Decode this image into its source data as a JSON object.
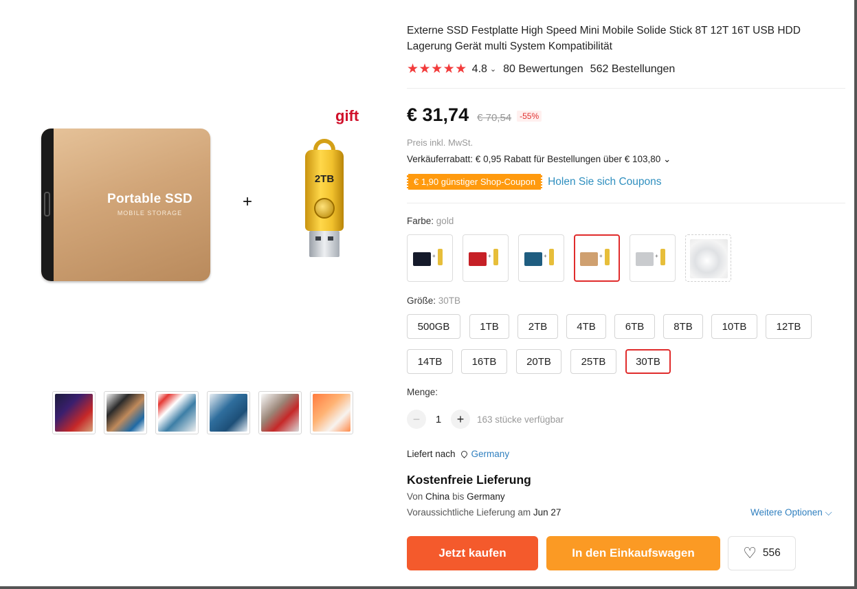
{
  "product": {
    "title": "Externe SSD Festplatte High Speed Mini Mobile Solide Stick 8T 12T 16T USB HDD Lagerung Gerät multi System Kompatibilität",
    "image": {
      "ssd_label": "Portable SSD",
      "ssd_sublabel": "MOBILE STORAGE",
      "plus": "+",
      "gift_label": "gift",
      "usb_label": "2TB"
    },
    "thumbnails": [
      "thumbnail-1",
      "thumbnail-2",
      "thumbnail-3",
      "thumbnail-4",
      "thumbnail-5",
      "thumbnail-6"
    ]
  },
  "rating": {
    "stars": "★★★★★",
    "value": "4.8",
    "chevron": "⌄",
    "reviews": "80 Bewertungen",
    "orders": "562 Bestellungen"
  },
  "price": {
    "current": "€ 31,74",
    "original": "€ 70,54",
    "discount": "-55%",
    "tax_note": "Preis inkl. MwSt.",
    "seller_discount": "Verkäuferrabatt: € 0,95 Rabatt für Bestellungen über € 103,80 ⌄",
    "coupon_badge": "€ 1,90 günstiger Shop-Coupon",
    "coupon_link": "Holen Sie sich Coupons"
  },
  "color": {
    "label": "Farbe:",
    "selected": "gold",
    "options": [
      {
        "name": "black",
        "ssd_color": "#151a2a"
      },
      {
        "name": "red",
        "ssd_color": "#c62026"
      },
      {
        "name": "blue",
        "ssd_color": "#1f5d80"
      },
      {
        "name": "gold",
        "ssd_color": "#cfa070"
      },
      {
        "name": "silver",
        "ssd_color": "#c9cbce"
      },
      {
        "name": "photo",
        "ssd_color": "#e6e6e6"
      }
    ]
  },
  "size": {
    "label": "Größe:",
    "selected": "30TB",
    "options": [
      "500GB",
      "1TB",
      "2TB",
      "4TB",
      "6TB",
      "8TB",
      "10TB",
      "12TB",
      "14TB",
      "16TB",
      "20TB",
      "25TB",
      "30TB"
    ]
  },
  "quantity": {
    "label": "Menge:",
    "minus": "−",
    "value": "1",
    "plus": "+",
    "stock": "163 stücke verfügbar"
  },
  "shipping": {
    "ship_to_label": "Liefert nach",
    "country": "Germany",
    "free_title": "Kostenfreie Lieferung",
    "from_prefix": "Von",
    "from": "China",
    "to_prefix": "bis",
    "to": "Germany",
    "eta_prefix": "Voraussichtliche Lieferung am",
    "eta_date": "Jun 27",
    "more_options": "Weitere Optionen ⌵"
  },
  "actions": {
    "buy_now": "Jetzt kaufen",
    "add_to_cart": "In den Einkaufswagen",
    "wishlist_icon": "♡",
    "wishlist_count": "556"
  },
  "colors": {
    "star": "#f23b3b",
    "buy_button": "#f45a2c",
    "cart_button": "#fb9a24",
    "coupon_badge": "#ff9a0e",
    "selected_border": "#e02b2b",
    "link": "#2f7fbf"
  }
}
